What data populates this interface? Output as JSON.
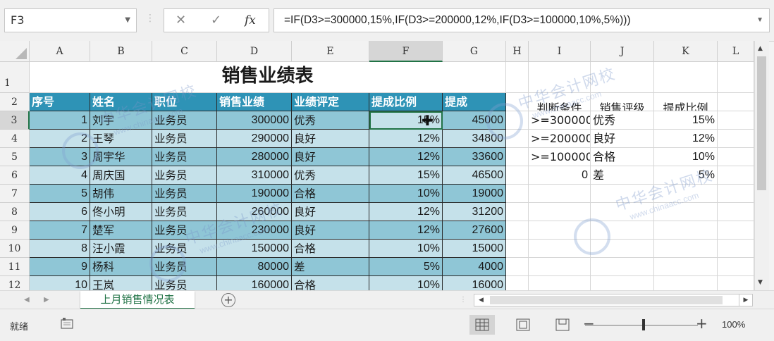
{
  "formula_bar": {
    "name_box": "F3",
    "cancel": "✕",
    "enter": "✓",
    "fx": "fx",
    "formula": "=IF(D3>=300000,15%,IF(D3>=200000,12%,IF(D3>=100000,10%,5%)))"
  },
  "columns": [
    "A",
    "B",
    "C",
    "D",
    "E",
    "F",
    "G",
    "H",
    "I",
    "J",
    "K",
    "L"
  ],
  "rows": [
    "1",
    "2",
    "3",
    "4",
    "5",
    "6",
    "7",
    "8",
    "9",
    "10",
    "11",
    "12"
  ],
  "title": "销售业绩表",
  "headers": [
    "序号",
    "姓名",
    "职位",
    "销售业绩",
    "业绩评定",
    "提成比例",
    "提成"
  ],
  "data_rows": [
    [
      "1",
      "刘宇",
      "业务员",
      "300000",
      "优秀",
      "15%",
      "45000"
    ],
    [
      "2",
      "王琴",
      "业务员",
      "290000",
      "良好",
      "12%",
      "34800"
    ],
    [
      "3",
      "周宇华",
      "业务员",
      "280000",
      "良好",
      "12%",
      "33600"
    ],
    [
      "4",
      "周庆国",
      "业务员",
      "310000",
      "优秀",
      "15%",
      "46500"
    ],
    [
      "5",
      "胡伟",
      "业务员",
      "190000",
      "合格",
      "10%",
      "19000"
    ],
    [
      "6",
      "佟小明",
      "业务员",
      "260000",
      "良好",
      "12%",
      "31200"
    ],
    [
      "7",
      "楚军",
      "业务员",
      "230000",
      "良好",
      "12%",
      "27600"
    ],
    [
      "8",
      "汪小霞",
      "业务员",
      "150000",
      "合格",
      "10%",
      "15000"
    ],
    [
      "9",
      "杨科",
      "业务员",
      "80000",
      "差",
      "5%",
      "4000"
    ],
    [
      "10",
      "王岚",
      "业务员",
      "160000",
      "合格",
      "10%",
      "16000"
    ]
  ],
  "lookup": {
    "headers": [
      "判断条件",
      "销售评级",
      "提成比例"
    ],
    "rows": [
      [
        ">=300000",
        "优秀",
        "15%"
      ],
      [
        ">=200000",
        "良好",
        "12%"
      ],
      [
        ">=100000",
        "合格",
        "10%"
      ],
      [
        "0",
        "差",
        "5%"
      ]
    ]
  },
  "sheet_tab": "上月销售情况表",
  "status": {
    "ready": "就绪",
    "zoom_minus": "−",
    "zoom_plus": "+",
    "zoom": "100%"
  },
  "watermark": {
    "cn": "中华会计网校",
    "en": "www.chinaacc.com"
  },
  "colors": {
    "header_fill": "#2e93b6",
    "band_dark": "#8fc6d6",
    "band_light": "#c5e1ea",
    "accent": "#217346"
  }
}
